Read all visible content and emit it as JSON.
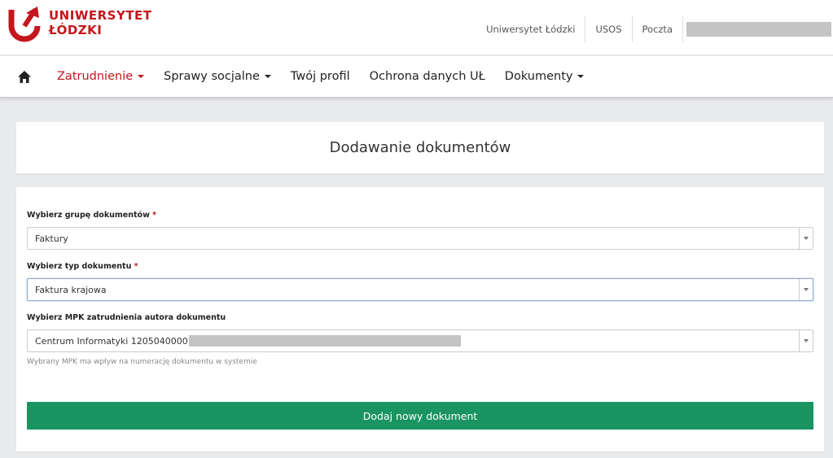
{
  "brand": {
    "line1": "UNIWERSYTET",
    "line2": "ŁÓDZKI",
    "color": "#c4161c"
  },
  "toplinks": [
    {
      "label": "Uniwersytet Łódzki"
    },
    {
      "label": "USOS"
    },
    {
      "label": "Poczta"
    }
  ],
  "nav": {
    "home_icon": "home-icon",
    "items": [
      {
        "label": "Zatrudnienie",
        "active": true,
        "dropdown": true
      },
      {
        "label": "Sprawy socjalne",
        "dropdown": true
      },
      {
        "label": "Twój profil"
      },
      {
        "label": "Ochrona danych UŁ"
      },
      {
        "label": "Dokumenty",
        "dropdown": true
      }
    ]
  },
  "page": {
    "title": "Dodawanie dokumentów"
  },
  "form": {
    "required_mark": "*",
    "group": {
      "label": "Wybierz grupę dokumentów",
      "value": "Faktury"
    },
    "type": {
      "label": "Wybierz typ dokumentu",
      "value": "Faktura krajowa"
    },
    "mpk": {
      "label": "Wybierz MPK zatrudnienia autora dokumentu",
      "value": "Centrum Informatyki 1205040000",
      "hint": "Wybrany MPK ma wpływ na numerację dokumentu w systemie"
    },
    "submit_label": "Dodaj nowy dokument",
    "submit_color": "#1a9461"
  }
}
